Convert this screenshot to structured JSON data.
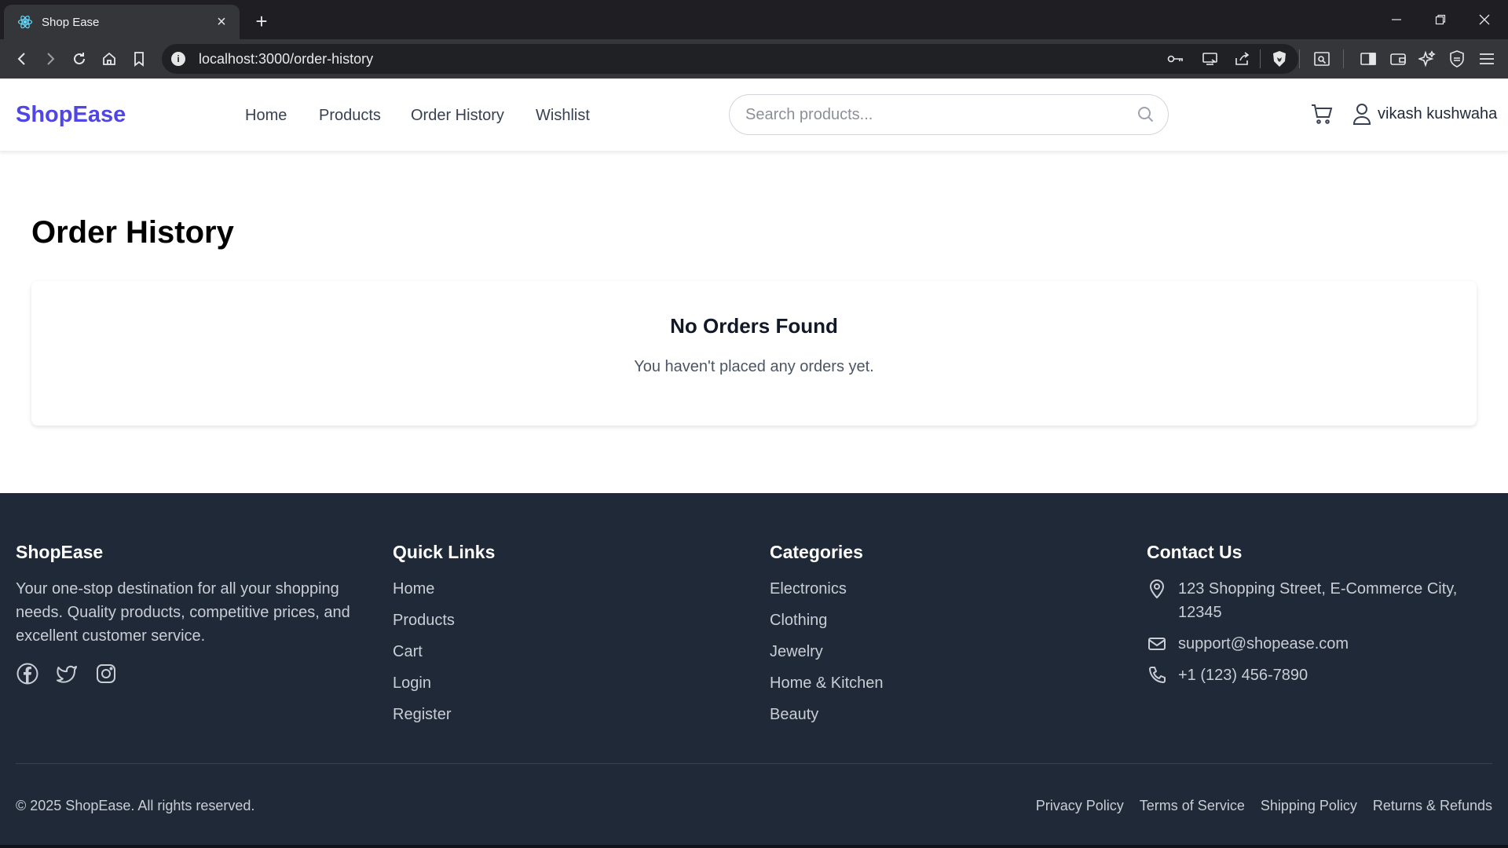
{
  "browser": {
    "tab_title": "Shop Ease",
    "url": "localhost:3000/order-history"
  },
  "header": {
    "logo": "ShopEase",
    "nav": [
      {
        "label": "Home"
      },
      {
        "label": "Products"
      },
      {
        "label": "Order History"
      },
      {
        "label": "Wishlist"
      }
    ],
    "search_placeholder": "Search products...",
    "user_name": "vikash kushwaha"
  },
  "main": {
    "title": "Order History",
    "empty_title": "No Orders Found",
    "empty_message": "You haven't placed any orders yet."
  },
  "footer": {
    "brand": "ShopEase",
    "description": "Your one-stop destination for all your shopping needs. Quality products, competitive prices, and excellent customer service.",
    "quick_links": {
      "heading": "Quick Links",
      "items": [
        "Home",
        "Products",
        "Cart",
        "Login",
        "Register"
      ]
    },
    "categories": {
      "heading": "Categories",
      "items": [
        "Electronics",
        "Clothing",
        "Jewelry",
        "Home & Kitchen",
        "Beauty"
      ]
    },
    "contact": {
      "heading": "Contact Us",
      "address": "123 Shopping Street, E-Commerce City, 12345",
      "email": "support@shopease.com",
      "phone": "+1 (123) 456-7890"
    },
    "copyright": "© 2025 ShopEase. All rights reserved.",
    "legal": [
      "Privacy Policy",
      "Terms of Service",
      "Shipping Policy",
      "Returns & Refunds"
    ]
  },
  "colors": {
    "brand": "#4f46e5",
    "footer_bg": "#1f2937"
  }
}
